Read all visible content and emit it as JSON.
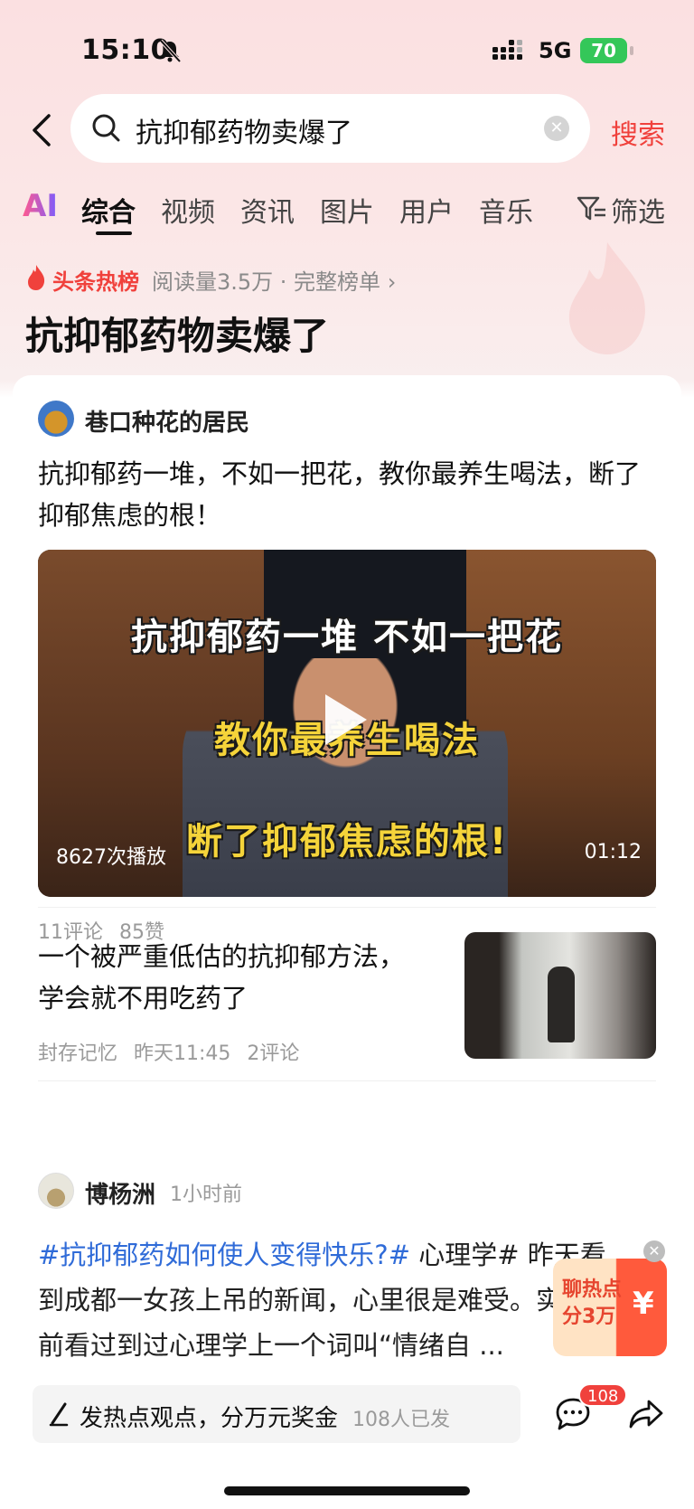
{
  "status_bar": {
    "time": "15:10",
    "network": "5G",
    "battery": "70"
  },
  "search": {
    "query": "抗抑郁药物卖爆了",
    "submit_label": "搜索"
  },
  "tabs": {
    "ai_label": "AI",
    "items": [
      "综合",
      "视频",
      "资讯",
      "图片",
      "用户",
      "音乐"
    ],
    "active": "综合",
    "filter_label": "筛选"
  },
  "hot_list": {
    "label": "头条热榜",
    "meta": "阅读量3.5万 · 完整榜单",
    "title": "抗抑郁药物卖爆了"
  },
  "post1": {
    "author": "巷口种花的居民",
    "text": "抗抑郁药一堆，不如一把花，教你最养生喝法，断了抑郁焦虑的根！",
    "video": {
      "caption_line1": "抗抑郁药一堆 不如一把花",
      "caption_line2": "教你最养生喝法",
      "caption_line3": "断了抑郁焦虑的根!",
      "play_count": "8627次播放",
      "duration": "01:12"
    },
    "comments": "11评论",
    "likes": "85赞"
  },
  "article": {
    "title": "一个被严重低估的抗抑郁方法，学会就不用吃药了",
    "source": "封存记忆",
    "time": "昨天11:45",
    "comments": "2评论"
  },
  "post2": {
    "author": "博杨洲",
    "time": "1小时前",
    "hashtag": "#抗抑郁药如何使人变得快乐?#",
    "text": " 心理学# 昨天看到成都一女孩上吊的新闻，心里很是难受。实到之前看过到过心理学上一个词叫“情绪自 ..."
  },
  "promo": {
    "text": "聊热点分3万",
    "currency": "¥"
  },
  "bottom_bar": {
    "post_label": "发热点观点，分万元奖金",
    "post_count": "108人已发",
    "comment_badge": "108"
  },
  "colors": {
    "accent": "#f0413c",
    "hashtag": "#2f6bd8",
    "battery": "#34c759"
  }
}
